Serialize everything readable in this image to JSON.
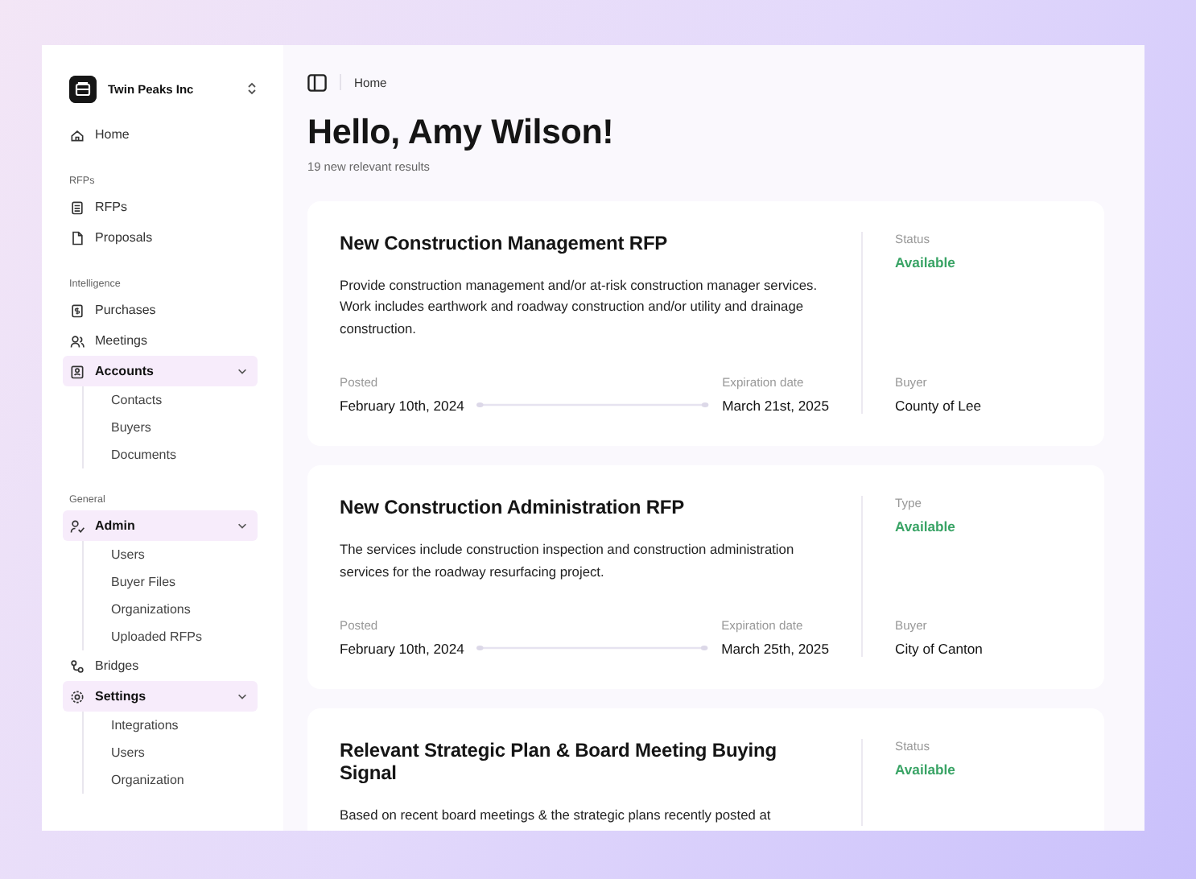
{
  "workspace": {
    "name": "Twin Peaks Inc"
  },
  "sidebar": {
    "items": [
      {
        "kind": "link",
        "label": "Home"
      },
      {
        "kind": "section",
        "label": "RFPs"
      },
      {
        "kind": "link",
        "label": "RFPs"
      },
      {
        "kind": "link",
        "label": "Proposals"
      },
      {
        "kind": "section",
        "label": "Intelligence"
      },
      {
        "kind": "link",
        "label": "Purchases"
      },
      {
        "kind": "link",
        "label": "Meetings"
      },
      {
        "kind": "group",
        "label": "Accounts",
        "expanded": true,
        "children": [
          {
            "label": "Contacts"
          },
          {
            "label": "Buyers"
          },
          {
            "label": "Documents"
          }
        ]
      },
      {
        "kind": "section",
        "label": "General"
      },
      {
        "kind": "group",
        "label": "Admin",
        "expanded": true,
        "children": [
          {
            "label": "Users"
          },
          {
            "label": "Buyer Files"
          },
          {
            "label": "Organizations"
          },
          {
            "label": "Uploaded RFPs"
          }
        ]
      },
      {
        "kind": "link",
        "label": "Bridges"
      },
      {
        "kind": "group",
        "label": "Settings",
        "expanded": true,
        "children": [
          {
            "label": "Integrations"
          },
          {
            "label": "Users"
          },
          {
            "label": "Organization"
          }
        ]
      }
    ]
  },
  "breadcrumb": "Home",
  "greeting": "Hello, Amy Wilson!",
  "subtitle": "19 new relevant results",
  "cards": [
    {
      "title": "New Construction Management RFP",
      "description": "Provide construction management and/or at-risk construction manager services. Work includes earthwork and roadway construction and/or utility and drainage construction.",
      "posted_label": "Posted",
      "posted": "February 10th, 2024",
      "expiration_label": "Expiration date",
      "expiration": "March 21st, 2025",
      "status_label": "Status",
      "status": "Available",
      "buyer_label": "Buyer",
      "buyer": "County of Lee"
    },
    {
      "title": "New Construction Administration RFP",
      "description": "The services include construction inspection and construction administration services for the roadway resurfacing project.",
      "posted_label": "Posted",
      "posted": "February 10th, 2024",
      "expiration_label": "Expiration date",
      "expiration": "March 25th, 2025",
      "status_label": "Type",
      "status": "Available",
      "buyer_label": "Buyer",
      "buyer": "City of Canton"
    },
    {
      "title": "Relevant Strategic Plan & Board Meeting Buying Signal",
      "description": "Based on recent board meetings & the strategic plans recently posted at",
      "status_label": "Status",
      "status": "Available"
    }
  ]
}
